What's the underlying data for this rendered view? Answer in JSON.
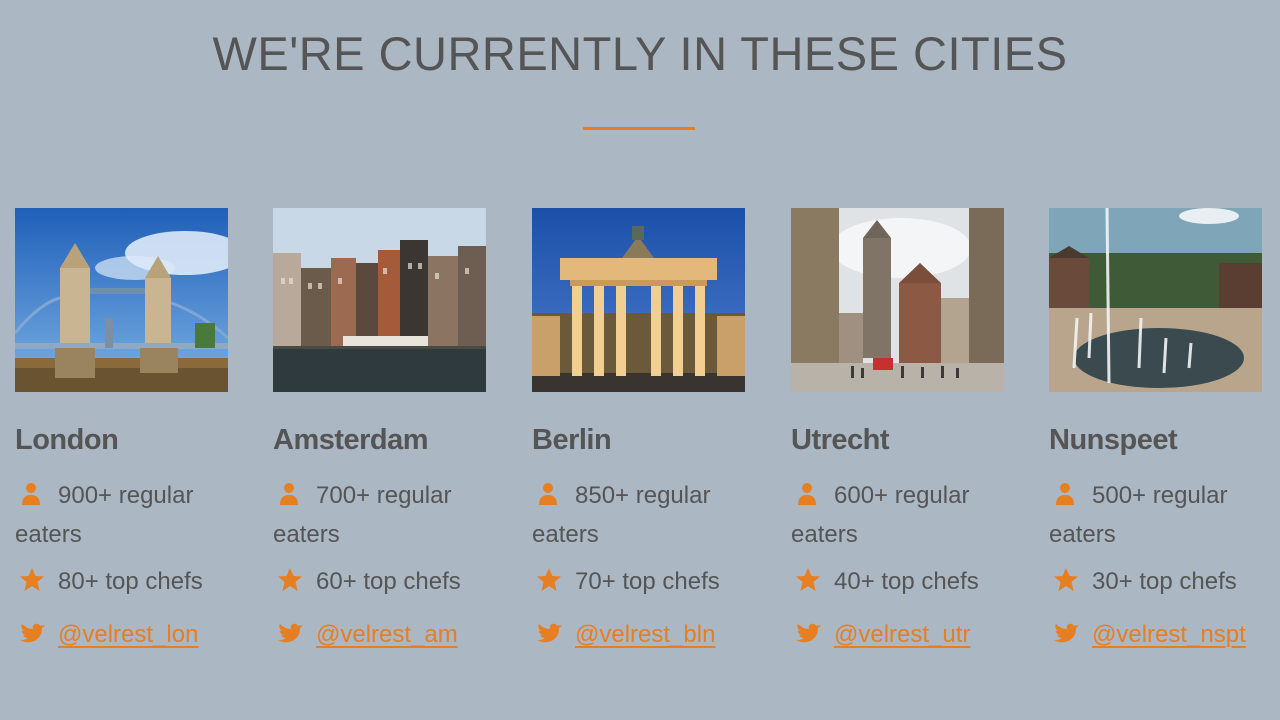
{
  "section": {
    "title": "WE'RE CURRENTLY IN THESE CITIES"
  },
  "colors": {
    "background": "#abb7c2",
    "accent": "#e67e22",
    "text": "#555555"
  },
  "icons": {
    "eaters": "person-icon",
    "chefs": "star-icon",
    "twitter": "twitter-bird-icon"
  },
  "cities": [
    {
      "name": "London",
      "eaters": "900+ regular eaters",
      "chefs": "80+ top chefs",
      "twitter": "@velrest_lon"
    },
    {
      "name": "Amsterdam",
      "eaters": "700+ regular eaters",
      "chefs": "60+ top chefs",
      "twitter": "@velrest_am"
    },
    {
      "name": "Berlin",
      "eaters": "850+ regular eaters",
      "chefs": "70+ top chefs",
      "twitter": "@velrest_bln"
    },
    {
      "name": "Utrecht",
      "eaters": "600+ regular eaters",
      "chefs": "40+ top chefs",
      "twitter": "@velrest_utr"
    },
    {
      "name": "Nunspeet",
      "eaters": "500+ regular eaters",
      "chefs": "30+ top chefs",
      "twitter": "@velrest_nspt"
    }
  ]
}
